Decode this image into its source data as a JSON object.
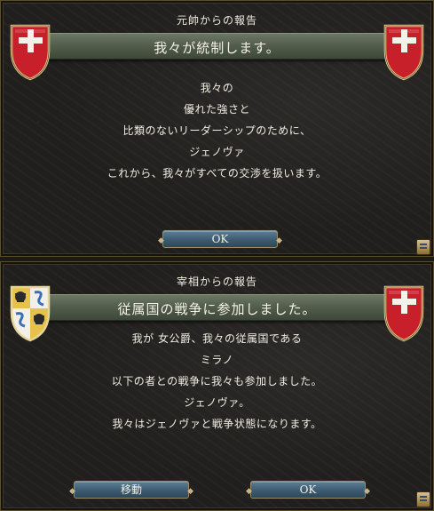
{
  "dialog1": {
    "header": "元帥からの報告",
    "title": "我々が統制します。",
    "lines": [
      "我々の",
      "優れた強さと",
      "比類のないリーダーシップのために、",
      "ジェノヴァ",
      "これから、我々がすべての交渉を扱います。"
    ],
    "ok_label": "OK",
    "left_shield": "genoa-cross-shield-icon",
    "right_shield": "genoa-cross-shield-icon"
  },
  "dialog2": {
    "header": "宰相からの報告",
    "title": "従属国の戦争に参加しました。",
    "lines": [
      "我が 女公爵、我々の従属国である",
      "ミラノ",
      "以下の者との戦争に我々も参加しました。",
      "ジェノヴァ。",
      "我々はジェノヴァと戦争状態になります。"
    ],
    "goto_label": "移動",
    "ok_label": "OK",
    "left_shield": "milan-quartered-shield-icon",
    "right_shield": "genoa-cross-shield-icon"
  },
  "colors": {
    "shield_red": "#c8202a",
    "banner_green": "#535e4c",
    "button_blue": "#3f5e73"
  }
}
